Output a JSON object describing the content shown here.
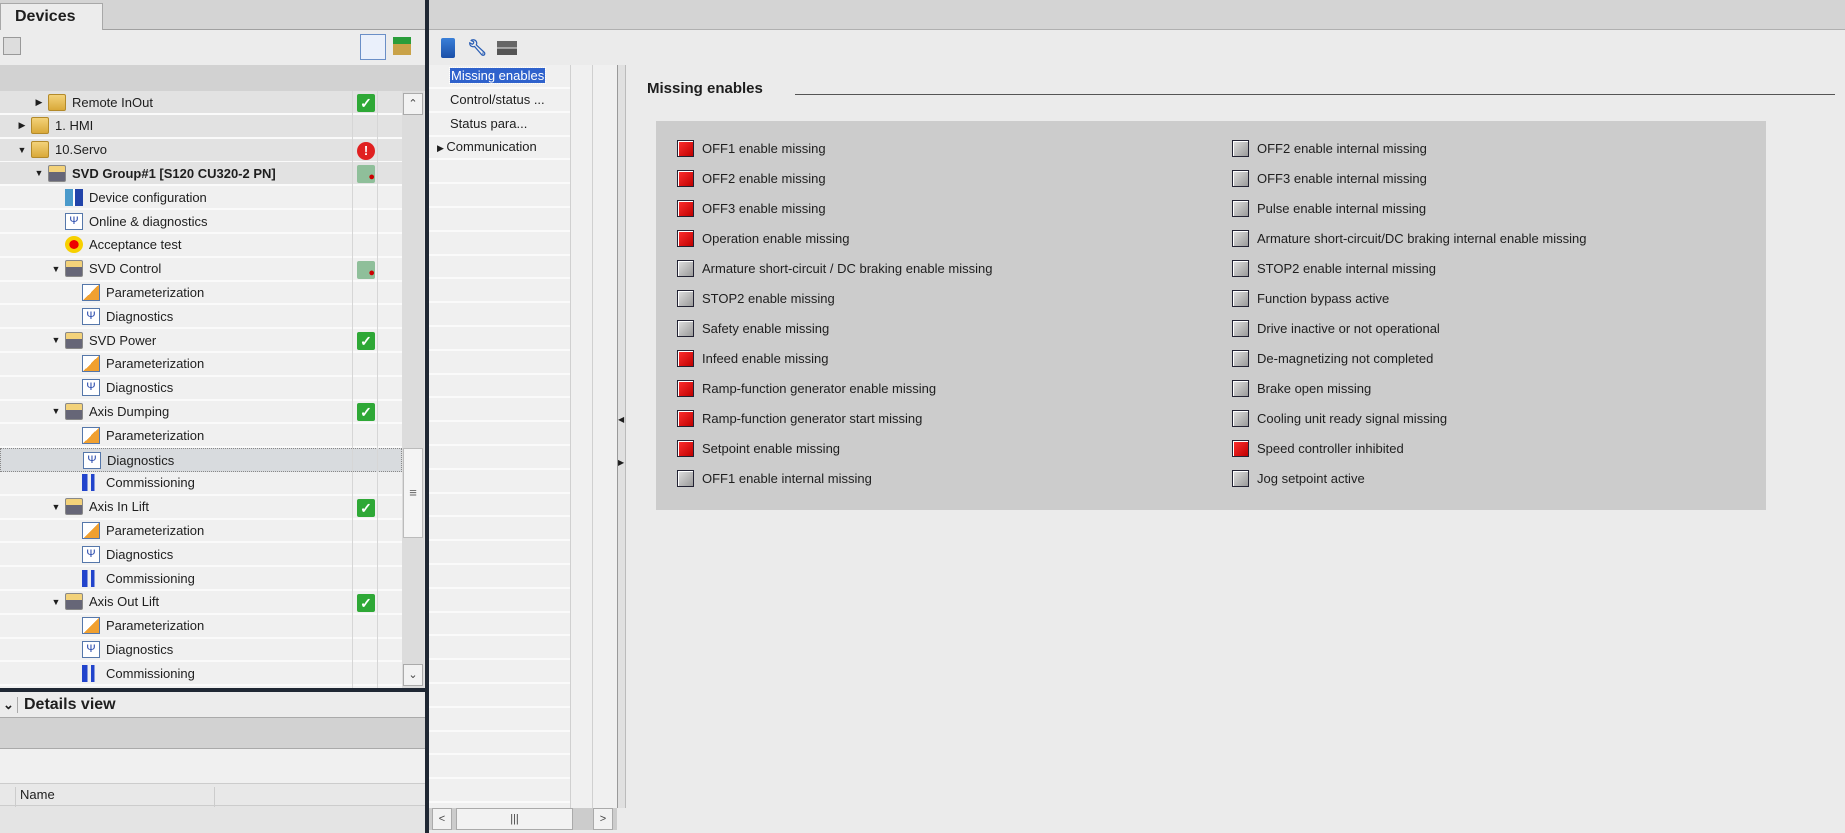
{
  "devices_tab": "Devices",
  "tree": [
    {
      "label": "Remote InOut",
      "level": 2,
      "icon": "folder-icon",
      "expander": "collapsed",
      "status": "ok"
    },
    {
      "label": "1. HMI",
      "level": 1,
      "icon": "folder-icon",
      "expander": "collapsed",
      "status": ""
    },
    {
      "label": "10.Servo",
      "level": 1,
      "icon": "folder-icon",
      "expander": "expanded",
      "status": "error"
    },
    {
      "label": "SVD Group#1 [S120 CU320-2 PN]",
      "level": 2,
      "icon": "drive-icon",
      "expander": "expanded",
      "status": "warning",
      "bold": true
    },
    {
      "label": "Device configuration",
      "level": 3,
      "icon": "device-config-icon",
      "expander": "",
      "status": ""
    },
    {
      "label": "Online & diagnostics",
      "level": 3,
      "icon": "diagnostics-icon",
      "expander": "",
      "status": ""
    },
    {
      "label": "Acceptance test",
      "level": 3,
      "icon": "acceptance-icon",
      "expander": "",
      "status": ""
    },
    {
      "label": "SVD Control",
      "level": 3,
      "icon": "drive-icon",
      "expander": "expanded",
      "status": "warning"
    },
    {
      "label": "Parameterization",
      "level": 4,
      "icon": "parameter-icon",
      "expander": "",
      "status": ""
    },
    {
      "label": "Diagnostics",
      "level": 4,
      "icon": "diagnostics-icon",
      "expander": "",
      "status": ""
    },
    {
      "label": "SVD Power",
      "level": 3,
      "icon": "drive-icon",
      "expander": "expanded",
      "status": "ok"
    },
    {
      "label": "Parameterization",
      "level": 4,
      "icon": "parameter-icon",
      "expander": "",
      "status": ""
    },
    {
      "label": "Diagnostics",
      "level": 4,
      "icon": "diagnostics-icon",
      "expander": "",
      "status": ""
    },
    {
      "label": "Axis Dumping",
      "level": 3,
      "icon": "drive-icon",
      "expander": "expanded",
      "status": "ok"
    },
    {
      "label": "Parameterization",
      "level": 4,
      "icon": "parameter-icon",
      "expander": "",
      "status": ""
    },
    {
      "label": "Diagnostics",
      "level": 4,
      "icon": "diagnostics-icon",
      "expander": "",
      "status": "",
      "selected": true
    },
    {
      "label": "Commissioning",
      "level": 4,
      "icon": "commissioning-icon",
      "expander": "",
      "status": ""
    },
    {
      "label": "Axis In Lift",
      "level": 3,
      "icon": "drive-icon",
      "expander": "expanded",
      "status": "ok"
    },
    {
      "label": "Parameterization",
      "level": 4,
      "icon": "parameter-icon",
      "expander": "",
      "status": ""
    },
    {
      "label": "Diagnostics",
      "level": 4,
      "icon": "diagnostics-icon",
      "expander": "",
      "status": ""
    },
    {
      "label": "Commissioning",
      "level": 4,
      "icon": "commissioning-icon",
      "expander": "",
      "status": ""
    },
    {
      "label": "Axis Out Lift",
      "level": 3,
      "icon": "drive-icon",
      "expander": "expanded",
      "status": "ok"
    },
    {
      "label": "Parameterization",
      "level": 4,
      "icon": "parameter-icon",
      "expander": "",
      "status": ""
    },
    {
      "label": "Diagnostics",
      "level": 4,
      "icon": "diagnostics-icon",
      "expander": "",
      "status": ""
    },
    {
      "label": "Commissioning",
      "level": 4,
      "icon": "commissioning-icon",
      "expander": "",
      "status": ""
    }
  ],
  "details": {
    "title": "Details view",
    "name_col": "Name"
  },
  "nav": [
    {
      "label": "Missing enables",
      "selected": true
    },
    {
      "label": "Control/status ..."
    },
    {
      "label": "Status para..."
    },
    {
      "label": "Communication",
      "expander": "collapsed"
    }
  ],
  "section_title": "Missing enables",
  "colors": {
    "led_on": "#e00000",
    "led_off": "#b0b0b0",
    "selection": "#2f62cc"
  },
  "enables_left": [
    {
      "label": "OFF1 enable missing",
      "active": true
    },
    {
      "label": "OFF2 enable missing",
      "active": true
    },
    {
      "label": "OFF3 enable missing",
      "active": true
    },
    {
      "label": "Operation enable missing",
      "active": true
    },
    {
      "label": "Armature short-circuit / DC braking enable missing",
      "active": false
    },
    {
      "label": "STOP2 enable missing",
      "active": false
    },
    {
      "label": "Safety enable missing",
      "active": false
    },
    {
      "label": "Infeed enable missing",
      "active": true
    },
    {
      "label": "Ramp-function generator enable missing",
      "active": true
    },
    {
      "label": "Ramp-function generator start missing",
      "active": true
    },
    {
      "label": "Setpoint enable missing",
      "active": true
    },
    {
      "label": "OFF1 enable internal missing",
      "active": false
    }
  ],
  "enables_right": [
    {
      "label": "OFF2 enable internal missing",
      "active": false
    },
    {
      "label": "OFF3 enable internal missing",
      "active": false
    },
    {
      "label": "Pulse enable internal missing",
      "active": false
    },
    {
      "label": "Armature short-circuit/DC braking internal enable missing",
      "active": false
    },
    {
      "label": "STOP2 enable internal missing",
      "active": false
    },
    {
      "label": "Function bypass active",
      "active": false
    },
    {
      "label": "Drive inactive or not operational",
      "active": false
    },
    {
      "label": "De-magnetizing not completed",
      "active": false
    },
    {
      "label": "Brake open missing",
      "active": false
    },
    {
      "label": "Cooling unit ready signal missing",
      "active": false
    },
    {
      "label": "Speed controller inhibited",
      "active": true
    },
    {
      "label": "Jog setpoint active",
      "active": false
    }
  ]
}
